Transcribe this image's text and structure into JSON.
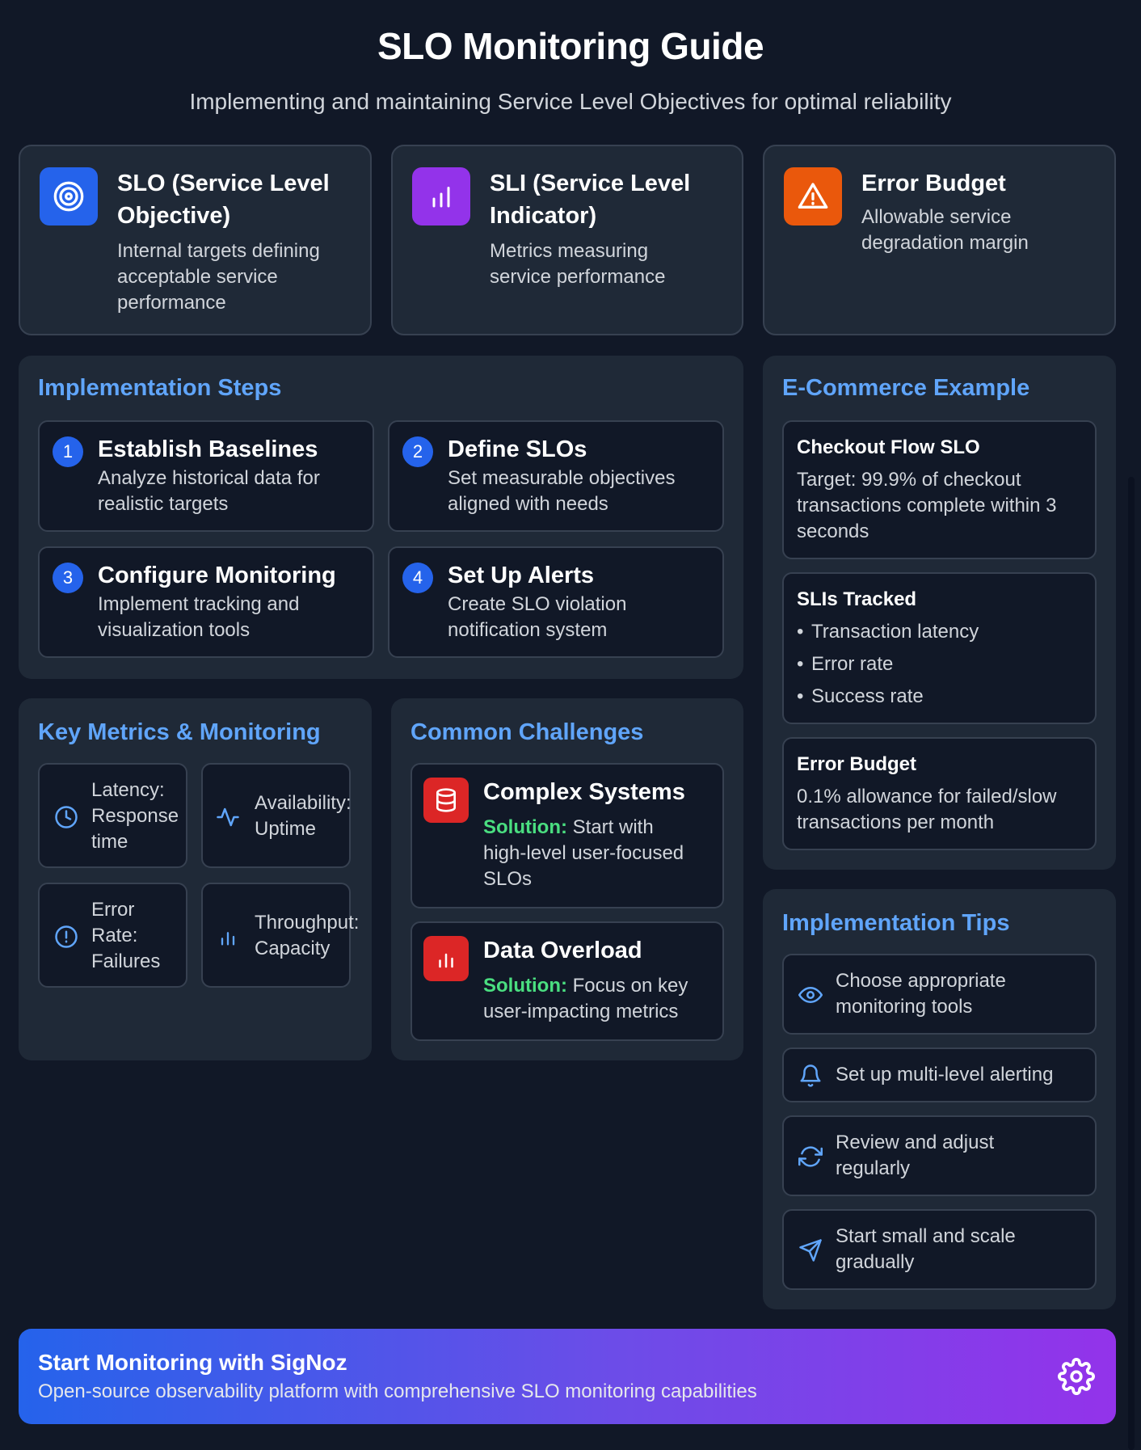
{
  "header": {
    "title": "SLO Monitoring Guide",
    "subtitle": "Implementing and maintaining Service Level Objectives for optimal reliability"
  },
  "definitions": [
    {
      "icon": "target-icon",
      "color": "#2563eb",
      "title_line1": "SLO (Service Level",
      "title_line2": "Objective)",
      "desc_line1": "Internal targets defining",
      "desc_line2": "acceptable service",
      "desc_line3": "performance"
    },
    {
      "icon": "bar-chart-icon",
      "color": "#9333ea",
      "title_line1": "SLI (Service Level",
      "title_line2": "Indicator)",
      "desc_line1": "Metrics measuring",
      "desc_line2": "service performance"
    },
    {
      "icon": "warning-icon",
      "color": "#ea580c",
      "title_line1": "Error Budget",
      "desc_line1": "Allowable service",
      "desc_line2": "degradation margin"
    }
  ],
  "implementation": {
    "title": "Implementation Steps",
    "steps": [
      {
        "num": "1",
        "title": "Establish Baselines",
        "desc_line1": "Analyze historical data for",
        "desc_line2": "realistic targets"
      },
      {
        "num": "2",
        "title": "Define SLOs",
        "desc_line1": "Set measurable objectives",
        "desc_line2": "aligned with needs"
      },
      {
        "num": "3",
        "title": "Configure Monitoring",
        "desc_line1": "Implement tracking and",
        "desc_line2": "visualization tools"
      },
      {
        "num": "4",
        "title": "Set Up Alerts",
        "desc_line1": "Create SLO violation",
        "desc_line2": "notification system"
      }
    ]
  },
  "metrics": {
    "title": "Key Metrics & Monitoring",
    "items": [
      {
        "icon": "clock-icon",
        "line1": "Latency:",
        "line2": "Response",
        "line3": "time"
      },
      {
        "icon": "activity-icon",
        "line1": "Availability:",
        "line2": "Uptime"
      },
      {
        "icon": "alert-circle-icon",
        "line1": "Error",
        "line2": "Rate:",
        "line3": "Failures"
      },
      {
        "icon": "bar-chart-icon",
        "line1": "Throughput:",
        "line2": "Capacity"
      }
    ]
  },
  "challenges": {
    "title": "Common Challenges",
    "items": [
      {
        "icon": "database-icon",
        "title": "Complex Systems",
        "solution_label": "Solution:",
        "line1": " Start with",
        "line2": "high-level user-focused",
        "line3": "SLOs"
      },
      {
        "icon": "bar-chart-icon",
        "title": "Data Overload",
        "solution_label": "Solution:",
        "line1": " Focus on key",
        "line2": "user-impacting metrics"
      }
    ]
  },
  "example": {
    "title": "E-Commerce Example",
    "checkout": {
      "title": "Checkout Flow SLO",
      "line1": "Target: 99.9% of checkout",
      "line2": "transactions complete within 3",
      "line3": "seconds"
    },
    "slis": {
      "title": "SLIs Tracked",
      "items": [
        "Transaction latency",
        "Error rate",
        "Success rate"
      ]
    },
    "budget": {
      "title": "Error Budget",
      "line1": "0.1% allowance for failed/slow",
      "line2": "transactions per month"
    }
  },
  "tips": {
    "title": "Implementation Tips",
    "items": [
      {
        "icon": "eye-icon",
        "line1": "Choose appropriate",
        "line2": "monitoring tools"
      },
      {
        "icon": "bell-icon",
        "line1": "Set up multi-level alerting"
      },
      {
        "icon": "refresh-icon",
        "line1": "Review and adjust",
        "line2": "regularly"
      },
      {
        "icon": "send-icon",
        "line1": "Start small and scale",
        "line2": "gradually"
      }
    ]
  },
  "banner": {
    "title": "Start Monitoring with SigNoz",
    "desc": "Open-source observability platform with comprehensive SLO monitoring capabilities",
    "icon": "gear-icon"
  },
  "colors": {
    "background": "#111827",
    "card": "#1f2937",
    "accent_blue": "#60a5fa",
    "solution_green": "#4ade80",
    "danger_red": "#dc2626"
  }
}
